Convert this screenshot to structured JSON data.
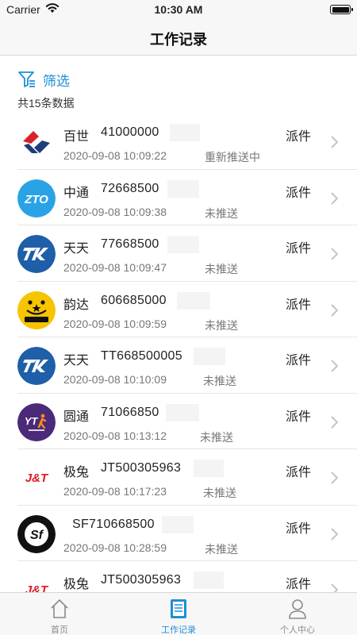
{
  "status_bar": {
    "carrier": "Carrier",
    "time": "10:30 AM"
  },
  "nav": {
    "title": "工作记录"
  },
  "filter": {
    "label": "筛选",
    "icon": "filter-icon"
  },
  "summary": {
    "count_text": "共15条数据"
  },
  "records": [
    {
      "company": "百世",
      "tracking": "41000000",
      "type": "派件",
      "time": "2020-09-08 10:09:22",
      "status": "重新推送中",
      "logo": "best-express-logo"
    },
    {
      "company": "中通",
      "tracking": "72668500",
      "type": "派件",
      "time": "2020-09-08 10:09:38",
      "status": "未推送",
      "logo": "zto-logo"
    },
    {
      "company": "天天",
      "tracking": "77668500",
      "type": "派件",
      "time": "2020-09-08 10:09:47",
      "status": "未推送",
      "logo": "tiantian-logo"
    },
    {
      "company": "韵达",
      "tracking": "606685000",
      "type": "派件",
      "time": "2020-09-08 10:09:59",
      "status": "未推送",
      "logo": "yunda-logo"
    },
    {
      "company": "天天",
      "tracking": "TT668500005",
      "type": "派件",
      "time": "2020-09-08 10:10:09",
      "status": "未推送",
      "logo": "tiantian-logo"
    },
    {
      "company": "圆通",
      "tracking": "71066850",
      "type": "派件",
      "time": "2020-09-08 10:13:12",
      "status": "未推送",
      "logo": "yto-logo"
    },
    {
      "company": "极兔",
      "tracking": "JT500305963",
      "type": "派件",
      "time": "2020-09-08 10:17:23",
      "status": "未推送",
      "logo": "jt-express-logo"
    },
    {
      "company": "",
      "tracking": "SF710668500",
      "type": "派件",
      "time": "2020-09-08 10:28:59",
      "status": "未推送",
      "logo": "sf-express-logo"
    },
    {
      "company": "极兔",
      "tracking": "JT500305963",
      "type": "派件",
      "time": "",
      "status": "",
      "logo": "jt-express-logo"
    }
  ],
  "tabs": [
    {
      "label": "首页",
      "icon": "home-icon",
      "active": false
    },
    {
      "label": "工作记录",
      "icon": "record-icon",
      "active": true
    },
    {
      "label": "个人中心",
      "icon": "profile-icon",
      "active": false
    }
  ],
  "colors": {
    "accent": "#1e8fd6",
    "nav_bg": "#f7f7f7",
    "text_secondary": "#777777"
  }
}
